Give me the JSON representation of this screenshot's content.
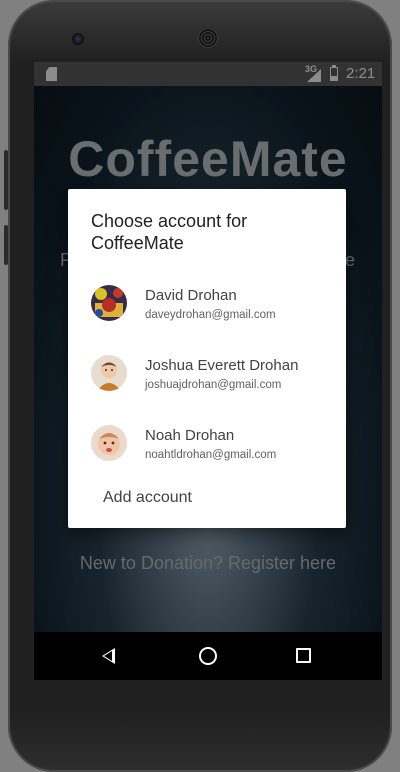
{
  "status_bar": {
    "network": "3G",
    "time": "2:21",
    "icons": [
      "sd-card-icon",
      "signal-icon",
      "battery-icon"
    ]
  },
  "background": {
    "app_title": "CoffeeMate",
    "left_fragment": "F",
    "right_fragment": "e",
    "register_text": "New to Donation? Register here"
  },
  "dialog": {
    "title": "Choose account for CoffeeMate",
    "accounts": [
      {
        "name": "David Drohan",
        "email": "daveydrohan@gmail.com"
      },
      {
        "name": "Joshua Everett Drohan",
        "email": "joshuajdrohan@gmail.com"
      },
      {
        "name": "Noah Drohan",
        "email": "noahtldrohan@gmail.com"
      }
    ],
    "add_account_label": "Add account"
  },
  "nav_bar": {
    "icons": [
      "back-icon",
      "home-icon",
      "recents-icon"
    ]
  },
  "colors": {
    "dialog_bg": "#ffffff",
    "status_bar": "#5c5c5c",
    "scrim": "rgba(0,0,0,0.45)"
  }
}
